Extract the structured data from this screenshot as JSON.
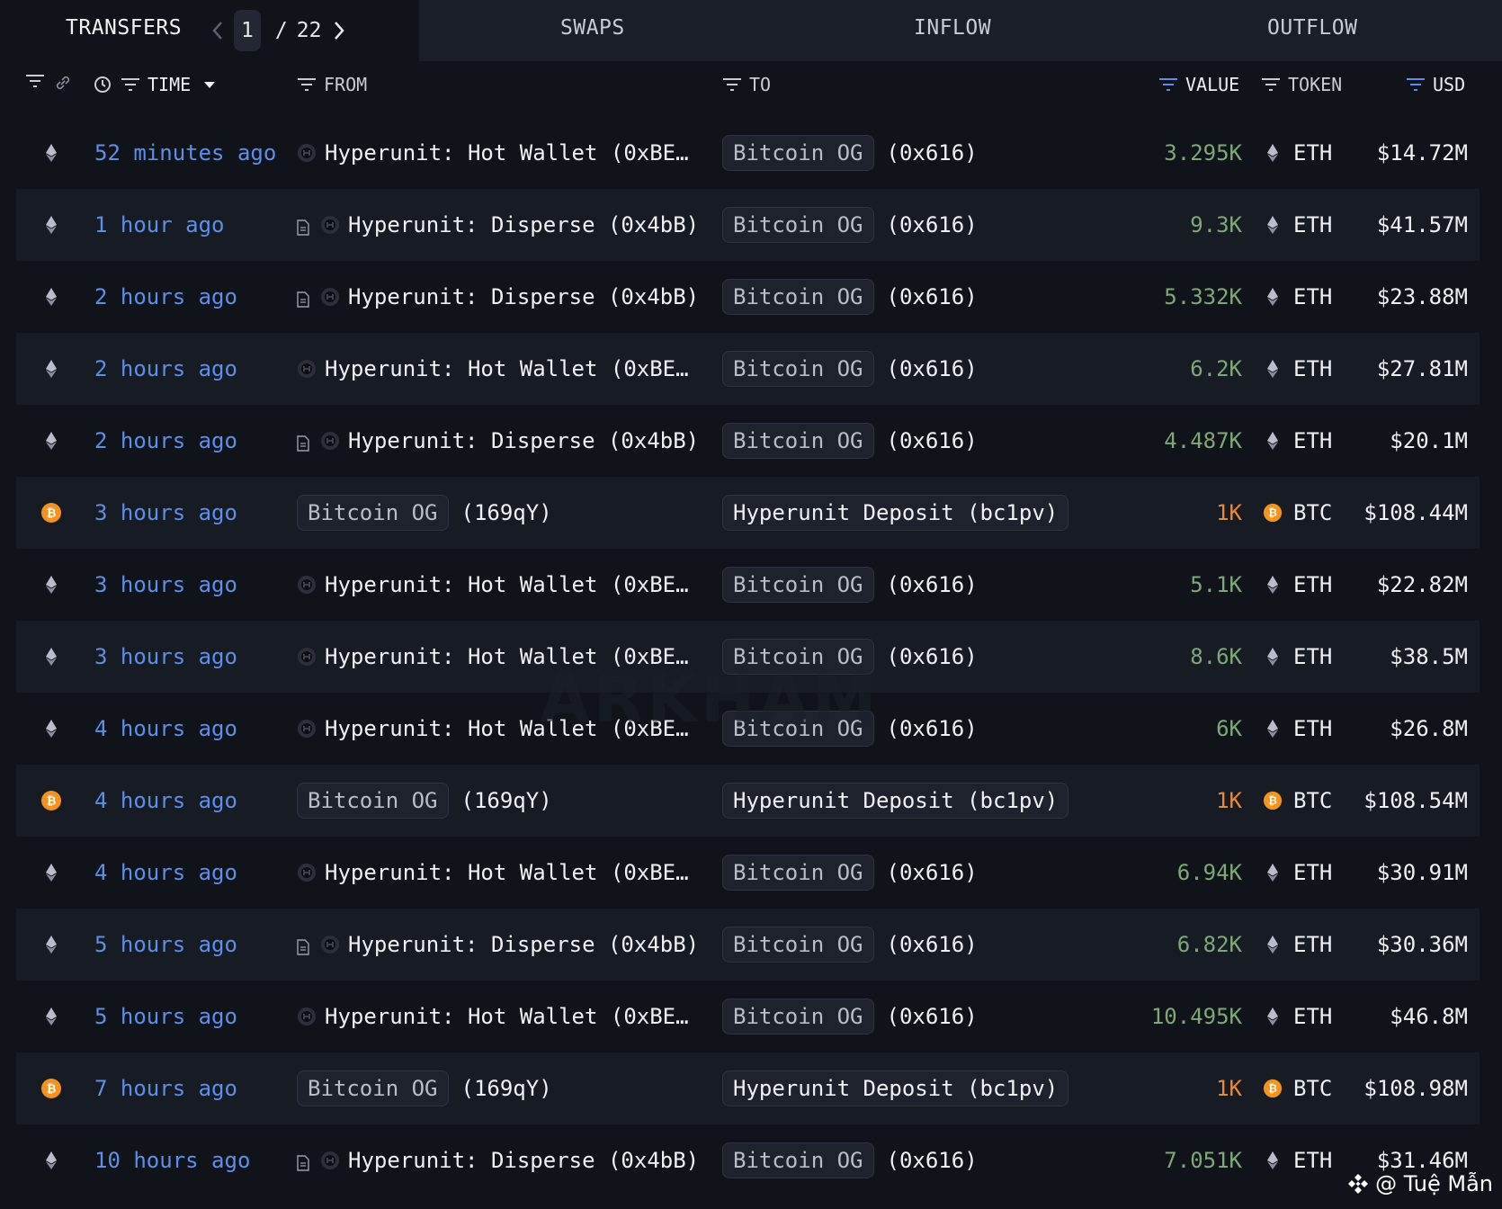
{
  "tabs": {
    "transfers": "TRANSFERS",
    "swaps": "SWAPS",
    "inflow": "INFLOW",
    "outflow": "OUTFLOW"
  },
  "pager": {
    "current": "1",
    "separator": "/",
    "total": "22"
  },
  "columns": {
    "time": "TIME",
    "from": "FROM",
    "to": "TO",
    "value": "VALUE",
    "token": "TOKEN",
    "usd": "USD"
  },
  "rows": [
    {
      "chain": "eth",
      "time": "52 minutes ago",
      "from_type": "entity",
      "from_icon": "none",
      "from": "Hyperunit: Hot Wallet (0xBE…",
      "to_type": "pill",
      "to_pill": "Bitcoin OG",
      "to_addr": "(0x616)",
      "value": "3.295K",
      "token": "ETH",
      "usd": "$14.72M"
    },
    {
      "chain": "eth",
      "time": "1 hour ago",
      "from_type": "entity",
      "from_icon": "doc",
      "from": "Hyperunit: Disperse (0x4bB)",
      "to_type": "pill",
      "to_pill": "Bitcoin OG",
      "to_addr": "(0x616)",
      "value": "9.3K",
      "token": "ETH",
      "usd": "$41.57M"
    },
    {
      "chain": "eth",
      "time": "2 hours ago",
      "from_type": "entity",
      "from_icon": "doc",
      "from": "Hyperunit: Disperse (0x4bB)",
      "to_type": "pill",
      "to_pill": "Bitcoin OG",
      "to_addr": "(0x616)",
      "value": "5.332K",
      "token": "ETH",
      "usd": "$23.88M"
    },
    {
      "chain": "eth",
      "time": "2 hours ago",
      "from_type": "entity",
      "from_icon": "none",
      "from": "Hyperunit: Hot Wallet (0xBE…",
      "to_type": "pill",
      "to_pill": "Bitcoin OG",
      "to_addr": "(0x616)",
      "value": "6.2K",
      "token": "ETH",
      "usd": "$27.81M"
    },
    {
      "chain": "eth",
      "time": "2 hours ago",
      "from_type": "entity",
      "from_icon": "doc",
      "from": "Hyperunit: Disperse (0x4bB)",
      "to_type": "pill",
      "to_pill": "Bitcoin OG",
      "to_addr": "(0x616)",
      "value": "4.487K",
      "token": "ETH",
      "usd": "$20.1M"
    },
    {
      "chain": "btc",
      "time": "3 hours ago",
      "from_type": "pill",
      "from_pill": "Bitcoin OG",
      "from_addr": "(169qY)",
      "to_type": "deposit",
      "to_pill": "Hyperunit Deposit (bc1pv)",
      "value": "1K",
      "token": "BTC",
      "usd": "$108.44M"
    },
    {
      "chain": "eth",
      "time": "3 hours ago",
      "from_type": "entity",
      "from_icon": "none",
      "from": "Hyperunit: Hot Wallet (0xBE…",
      "to_type": "pill",
      "to_pill": "Bitcoin OG",
      "to_addr": "(0x616)",
      "value": "5.1K",
      "token": "ETH",
      "usd": "$22.82M"
    },
    {
      "chain": "eth",
      "time": "3 hours ago",
      "from_type": "entity",
      "from_icon": "none",
      "from": "Hyperunit: Hot Wallet (0xBE…",
      "to_type": "pill",
      "to_pill": "Bitcoin OG",
      "to_addr": "(0x616)",
      "value": "8.6K",
      "token": "ETH",
      "usd": "$38.5M"
    },
    {
      "chain": "eth",
      "time": "4 hours ago",
      "from_type": "entity",
      "from_icon": "none",
      "from": "Hyperunit: Hot Wallet (0xBE…",
      "to_type": "pill",
      "to_pill": "Bitcoin OG",
      "to_addr": "(0x616)",
      "value": "6K",
      "token": "ETH",
      "usd": "$26.8M"
    },
    {
      "chain": "btc",
      "time": "4 hours ago",
      "from_type": "pill",
      "from_pill": "Bitcoin OG",
      "from_addr": "(169qY)",
      "to_type": "deposit",
      "to_pill": "Hyperunit Deposit (bc1pv)",
      "value": "1K",
      "token": "BTC",
      "usd": "$108.54M"
    },
    {
      "chain": "eth",
      "time": "4 hours ago",
      "from_type": "entity",
      "from_icon": "none",
      "from": "Hyperunit: Hot Wallet (0xBE…",
      "to_type": "pill",
      "to_pill": "Bitcoin OG",
      "to_addr": "(0x616)",
      "value": "6.94K",
      "token": "ETH",
      "usd": "$30.91M"
    },
    {
      "chain": "eth",
      "time": "5 hours ago",
      "from_type": "entity",
      "from_icon": "doc",
      "from": "Hyperunit: Disperse (0x4bB)",
      "to_type": "pill",
      "to_pill": "Bitcoin OG",
      "to_addr": "(0x616)",
      "value": "6.82K",
      "token": "ETH",
      "usd": "$30.36M"
    },
    {
      "chain": "eth",
      "time": "5 hours ago",
      "from_type": "entity",
      "from_icon": "none",
      "from": "Hyperunit: Hot Wallet (0xBE…",
      "to_type": "pill",
      "to_pill": "Bitcoin OG",
      "to_addr": "(0x616)",
      "value": "10.495K",
      "token": "ETH",
      "usd": "$46.8M"
    },
    {
      "chain": "btc",
      "time": "7 hours ago",
      "from_type": "pill",
      "from_pill": "Bitcoin OG",
      "from_addr": "(169qY)",
      "to_type": "deposit",
      "to_pill": "Hyperunit Deposit (bc1pv)",
      "value": "1K",
      "token": "BTC",
      "usd": "$108.98M"
    },
    {
      "chain": "eth",
      "time": "10 hours ago",
      "from_type": "entity",
      "from_icon": "doc",
      "from": "Hyperunit: Disperse (0x4bB)",
      "to_type": "pill",
      "to_pill": "Bitcoin OG",
      "to_addr": "(0x616)",
      "value": "7.051K",
      "token": "ETH",
      "usd": "$31.46M"
    }
  ],
  "watermark": "ARKHAM",
  "credit": "@ Tuệ Mẫn",
  "colors": {
    "background": "#10131a",
    "row_alt": "#171b24",
    "time_link": "#5e8fe8",
    "value_eth": "#7ea877",
    "value_btc": "#e88a3a",
    "btc_icon": "#f7931a"
  }
}
